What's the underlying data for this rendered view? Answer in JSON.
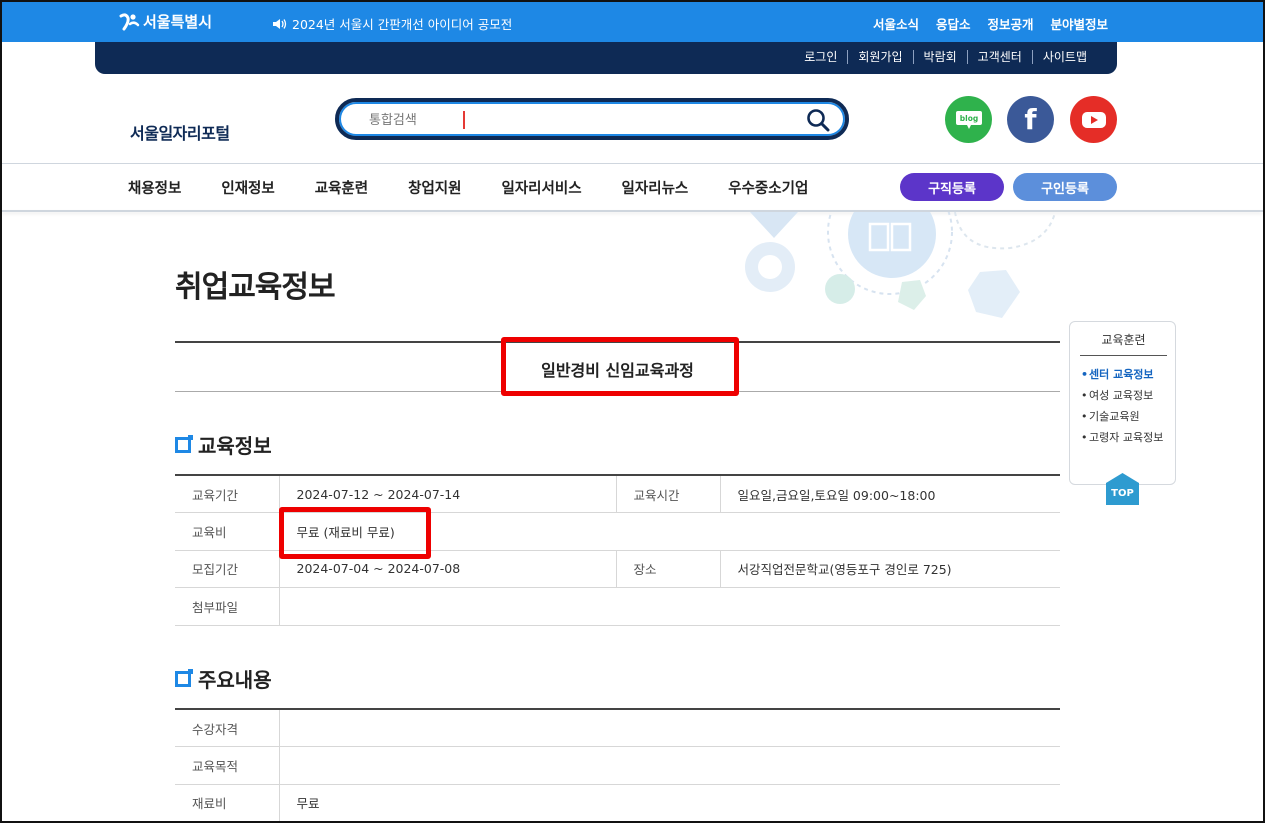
{
  "topbar": {
    "logo_text": "서울특별시",
    "notice": "2024년 서울시 간판개선 아이디어 공모전",
    "links": [
      "서울소식",
      "응답소",
      "정보공개",
      "분야별정보"
    ]
  },
  "utility": {
    "links": [
      "로그인",
      "회원가입",
      "박람회",
      "고객센터",
      "사이트맵"
    ]
  },
  "header": {
    "portal_name": "서울일자리포털",
    "search_placeholder": "통합검색",
    "sns": {
      "blog": "blog",
      "facebook": "f"
    }
  },
  "gnb": {
    "items": [
      "채용정보",
      "인재정보",
      "교육훈련",
      "창업지원",
      "일자리서비스",
      "일자리뉴스",
      "우수중소기업"
    ],
    "job_register": "구직등록",
    "hire_register": "구인등록"
  },
  "page": {
    "title": "취업교육정보",
    "course_title": "일반경비 신임교육과정"
  },
  "edu_info": {
    "heading": "교육정보",
    "rows": {
      "period_label": "교육기간",
      "period_value": "2024-07-12 ~ 2024-07-14",
      "time_label": "교육시간",
      "time_value": "일요일,금요일,토요일 09:00~18:00",
      "fee_label": "교육비",
      "fee_value": "무료 (재료비 무료)",
      "recruit_label": "모집기간",
      "recruit_value": "2024-07-04 ~ 2024-07-08",
      "place_label": "장소",
      "place_value": "서강직업전문학교(영등포구 경인로 725)",
      "file_label": "첨부파일",
      "file_value": ""
    }
  },
  "main_content": {
    "heading": "주요내용",
    "rows": {
      "qual_label": "수강자격",
      "qual_value": "",
      "purpose_label": "교육목적",
      "purpose_value": "",
      "material_label": "재료비",
      "material_value": "무료"
    }
  },
  "quick_menu": {
    "title": "교육훈련",
    "items": [
      "센터 교육정보",
      "여성 교육정보",
      "기술교육원",
      "고령자 교육정보"
    ],
    "top_label": "TOP"
  },
  "colors": {
    "topbar": "#1e88e5",
    "navy": "#0e2a55",
    "job_register": "#5c35c9",
    "hire_register": "#5c8fdb",
    "highlight": "#ee0000"
  }
}
